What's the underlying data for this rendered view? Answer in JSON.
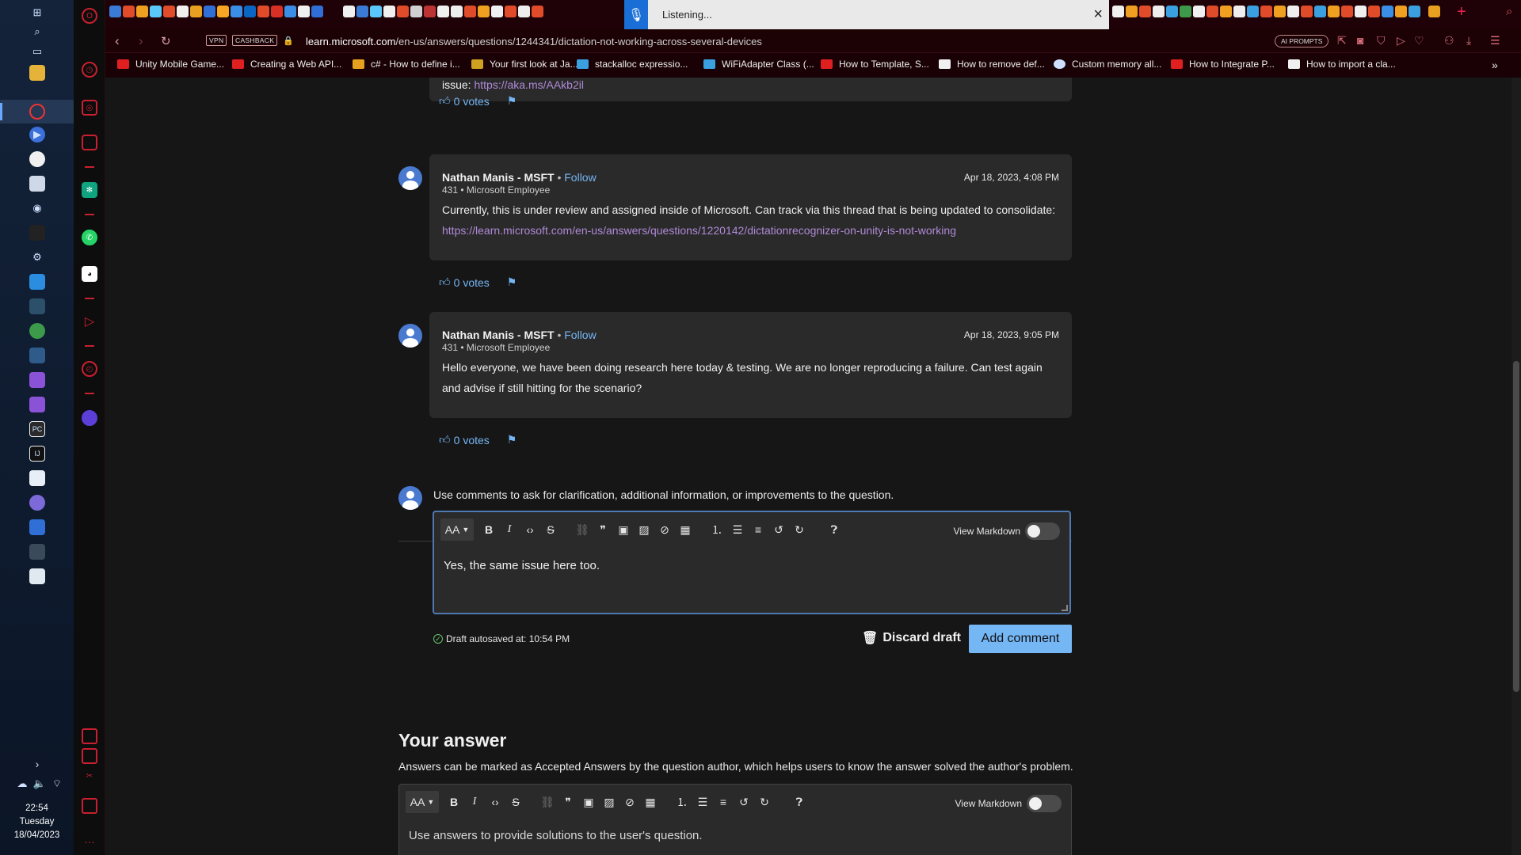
{
  "taskbar": {
    "time": "22:54",
    "day": "Tuesday",
    "date": "18/04/2023"
  },
  "browser": {
    "active_tab": {
      "title": "Listening...",
      "close_label": "×"
    },
    "badges": {
      "vpn": "VPN",
      "cashback": "CASHBACK"
    },
    "url_domain": "learn.microsoft.com",
    "url_path": "/en-us/answers/questions/1244341/dictation-not-working-across-several-devices",
    "ai_prompts": "AI PROMPTS",
    "bookmarks": [
      {
        "label": "Unity Mobile Game...",
        "color": "#e02020"
      },
      {
        "label": "Creating a Web API...",
        "color": "#e02020"
      },
      {
        "label": "c# - How to define i...",
        "color": "#e8a020"
      },
      {
        "label": "Your first look at Ja...",
        "color": "#d0a020"
      },
      {
        "label": "stackalloc expressio...",
        "color": "#3aa0e0"
      },
      {
        "label": "WiFiAdapter Class (...",
        "color": "#3aa0e0"
      },
      {
        "label": "How to Template, S...",
        "color": "#e02020"
      },
      {
        "label": "How to remove def...",
        "color": "#f0f0f0"
      },
      {
        "label": "Custom memory all...",
        "color": "#cfe0ff"
      },
      {
        "label": "How to Integrate P...",
        "color": "#e02020"
      },
      {
        "label": "How to import a cla...",
        "color": "#f0f0f0"
      }
    ]
  },
  "thread": {
    "top_card_partial_text": "issue:",
    "top_card_partial_link": "https://aka.ms/AAkb2il",
    "top_votes": "0 votes",
    "comments": [
      {
        "author": "Nathan Manis - MSFT",
        "follow": "Follow",
        "meta": "431 • Microsoft Employee",
        "date": "Apr 18, 2023, 4:08 PM",
        "text": "Currently, this is under review and assigned inside of Microsoft. Can track via this thread that is being updated to consolidate:",
        "link": "https://learn.microsoft.com/en-us/answers/questions/1220142/dictationrecognizer-on-unity-is-not-working",
        "votes": "0 votes"
      },
      {
        "author": "Nathan Manis - MSFT",
        "follow": "Follow",
        "meta": "431 • Microsoft Employee",
        "date": "Apr 18, 2023, 9:05 PM",
        "text": "Hello everyone, we have been doing research here today & testing. We are no longer reproducing a failure. Can test again and advise if still hitting for the scenario?",
        "votes": "0 votes"
      }
    ]
  },
  "comment_editor": {
    "hint": "Use comments to ask for clarification, additional information, or improvements to the question.",
    "format_label": "AA",
    "view_markdown": "View Markdown",
    "text": "Yes, the same issue here too.",
    "draft_status": "Draft autosaved at: 10:54 PM",
    "discard_label": "Discard draft",
    "add_label": "Add comment"
  },
  "your_answer": {
    "title": "Your answer",
    "description": "Answers can be marked as Accepted Answers by the question author, which helps users to know the answer solved the author's problem.",
    "format_label": "AA",
    "view_markdown": "View Markdown",
    "placeholder": "Use answers to provide solutions to the user's question."
  },
  "colors": {
    "accent": "#75b6f5",
    "opera_red": "#c8202f",
    "link": "#b08ad8"
  }
}
